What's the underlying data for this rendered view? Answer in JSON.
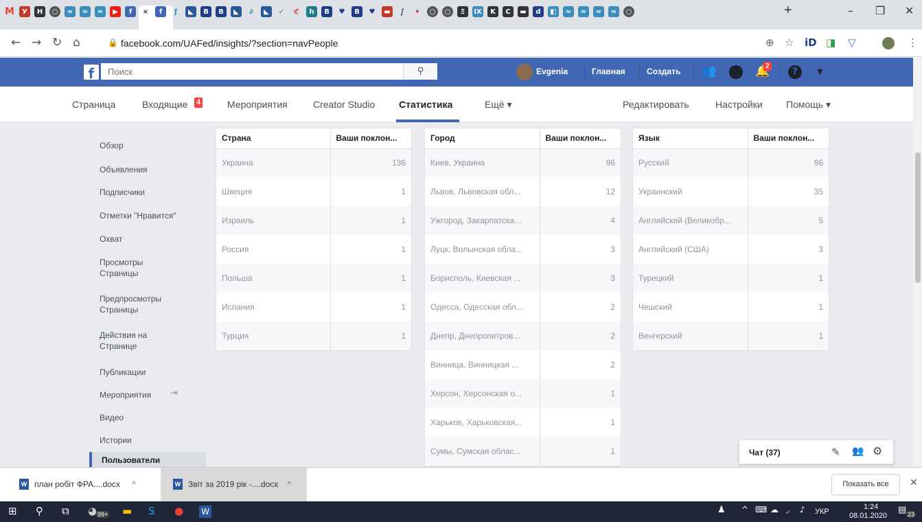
{
  "browser": {
    "tab_close": "×",
    "new_tab": "+",
    "url": "facebook.com/UAFed/insights/?section=navPeople"
  },
  "fb": {
    "search_placeholder": "Поиск",
    "user_name": "Evgenia",
    "nav_home": "Главная",
    "nav_create": "Создать",
    "notif_count": "2"
  },
  "page_tabs": {
    "page": "Страница",
    "inbox": "Входящие",
    "inbox_badge": "4",
    "events": "Мероприятия",
    "creator_studio": "Creator Studio",
    "insights": "Статистика",
    "more": "Ещё ▾",
    "edit": "Редактировать",
    "settings": "Настройки",
    "help": "Помощь ▾"
  },
  "sidebar": {
    "items": [
      "Обзор",
      "Объявления",
      "Подписчики",
      "Отметки \"Нравится\"",
      "Охват",
      "Просмотры Страницы",
      "Предпросмотры Страницы",
      "Действия на Странице",
      "Публикации",
      "Мероприятия",
      "Видео",
      "Истории",
      "Пользователи"
    ]
  },
  "tables": {
    "country": {
      "header_name": "Страна",
      "header_value": "Ваши поклон...",
      "rows": [
        {
          "name": "Украина",
          "value": "136"
        },
        {
          "name": "Швеция",
          "value": "1"
        },
        {
          "name": "Израиль",
          "value": "1"
        },
        {
          "name": "Россия",
          "value": "1"
        },
        {
          "name": "Польша",
          "value": "1"
        },
        {
          "name": "Испания",
          "value": "1"
        },
        {
          "name": "Турция",
          "value": "1"
        }
      ]
    },
    "city": {
      "header_name": "Город",
      "header_value": "Ваши поклон...",
      "rows": [
        {
          "name": "Киев, Украина",
          "value": "96"
        },
        {
          "name": "Львов, Львовская обл...",
          "value": "12"
        },
        {
          "name": "Ужгород, Закарпатска...",
          "value": "4"
        },
        {
          "name": "Луцк, Волынская обла...",
          "value": "3"
        },
        {
          "name": "Борисполь, Киевская ...",
          "value": "3"
        },
        {
          "name": "Одесса, Одесская обл...",
          "value": "2"
        },
        {
          "name": "Днепр, Днепропетров...",
          "value": "2"
        },
        {
          "name": "Винница, Винницкая ...",
          "value": "2"
        },
        {
          "name": "Херсон, Херсонская о...",
          "value": "1"
        },
        {
          "name": "Харьков, Харьковская...",
          "value": "1"
        },
        {
          "name": "Сумы, Сумская облас...",
          "value": "1"
        }
      ]
    },
    "language": {
      "header_name": "Язык",
      "header_value": "Ваши поклон...",
      "rows": [
        {
          "name": "Русский",
          "value": "96"
        },
        {
          "name": "Украинский",
          "value": "35"
        },
        {
          "name": "Английский (Великобр...",
          "value": "5"
        },
        {
          "name": "Английский (США)",
          "value": "3"
        },
        {
          "name": "Турецкий",
          "value": "1"
        },
        {
          "name": "Чешский",
          "value": "1"
        },
        {
          "name": "Венгерский",
          "value": "1"
        }
      ]
    }
  },
  "chat": {
    "label": "Чат (37)"
  },
  "downloads": {
    "item1": "план робіт ФРА....docx",
    "item2": "Звіт за 2019 рік -....docx",
    "show_all": "Показать все"
  },
  "taskbar": {
    "lang": "УКР",
    "time": "1:24",
    "date": "08.01.2020",
    "notif": "23",
    "edge_badge": "99+"
  }
}
